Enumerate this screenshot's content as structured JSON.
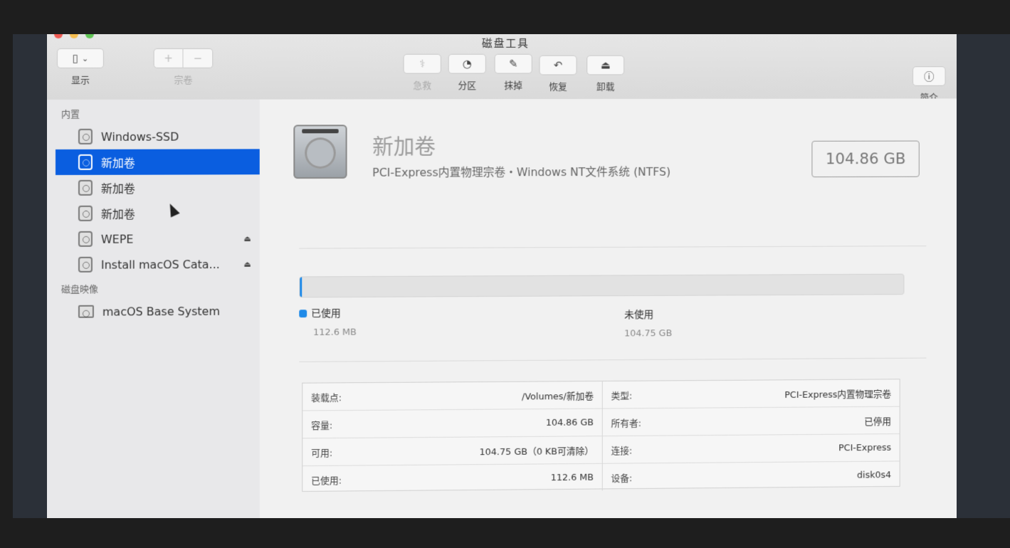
{
  "window": {
    "title": "磁盘工具",
    "traffic_colors": [
      "#ee5a52",
      "#f5bd4f",
      "#5fc454"
    ]
  },
  "toolbar": {
    "view_label": "显示",
    "volume_label": "宗卷",
    "volume_add": "+",
    "volume_remove": "−",
    "firstaid_label": "急救",
    "partition_label": "分区",
    "erase_label": "抹掉",
    "restore_label": "恢复",
    "unmount_label": "卸载",
    "info_label": "简介"
  },
  "sidebar": {
    "internal_header": "内置",
    "images_header": "磁盘映像",
    "items": [
      {
        "label": "Windows-SSD"
      },
      {
        "label": "新加卷"
      },
      {
        "label": "新加卷"
      },
      {
        "label": "新加卷"
      },
      {
        "label": "WEPE"
      },
      {
        "label": "Install macOS Cata..."
      }
    ],
    "image_items": [
      {
        "label": "macOS Base System"
      }
    ],
    "accent_color": "#0a5ee0"
  },
  "main": {
    "volume_name": "新加卷",
    "volume_subtitle": "PCI-Express内置物理宗卷・Windows NT文件系统 (NTFS)",
    "volume_size": "104.86 GB",
    "used_fraction": 0.001,
    "used_label": "已使用",
    "used_value": "112.6 MB",
    "free_label": "未使用",
    "free_value": "104.75 GB",
    "used_color": "#1f8ae8"
  },
  "info": {
    "left": [
      {
        "key": "装载点:",
        "value": "/Volumes/新加卷"
      },
      {
        "key": "容量:",
        "value": "104.86 GB"
      },
      {
        "key": "可用:",
        "value": "104.75 GB（0 KB可清除）"
      },
      {
        "key": "已使用:",
        "value": "112.6 MB"
      }
    ],
    "right": [
      {
        "key": "类型:",
        "value": "PCI-Express内置物理宗卷"
      },
      {
        "key": "所有者:",
        "value": "已停用"
      },
      {
        "key": "连接:",
        "value": "PCI-Express"
      },
      {
        "key": "设备:",
        "value": "disk0s4"
      }
    ]
  }
}
